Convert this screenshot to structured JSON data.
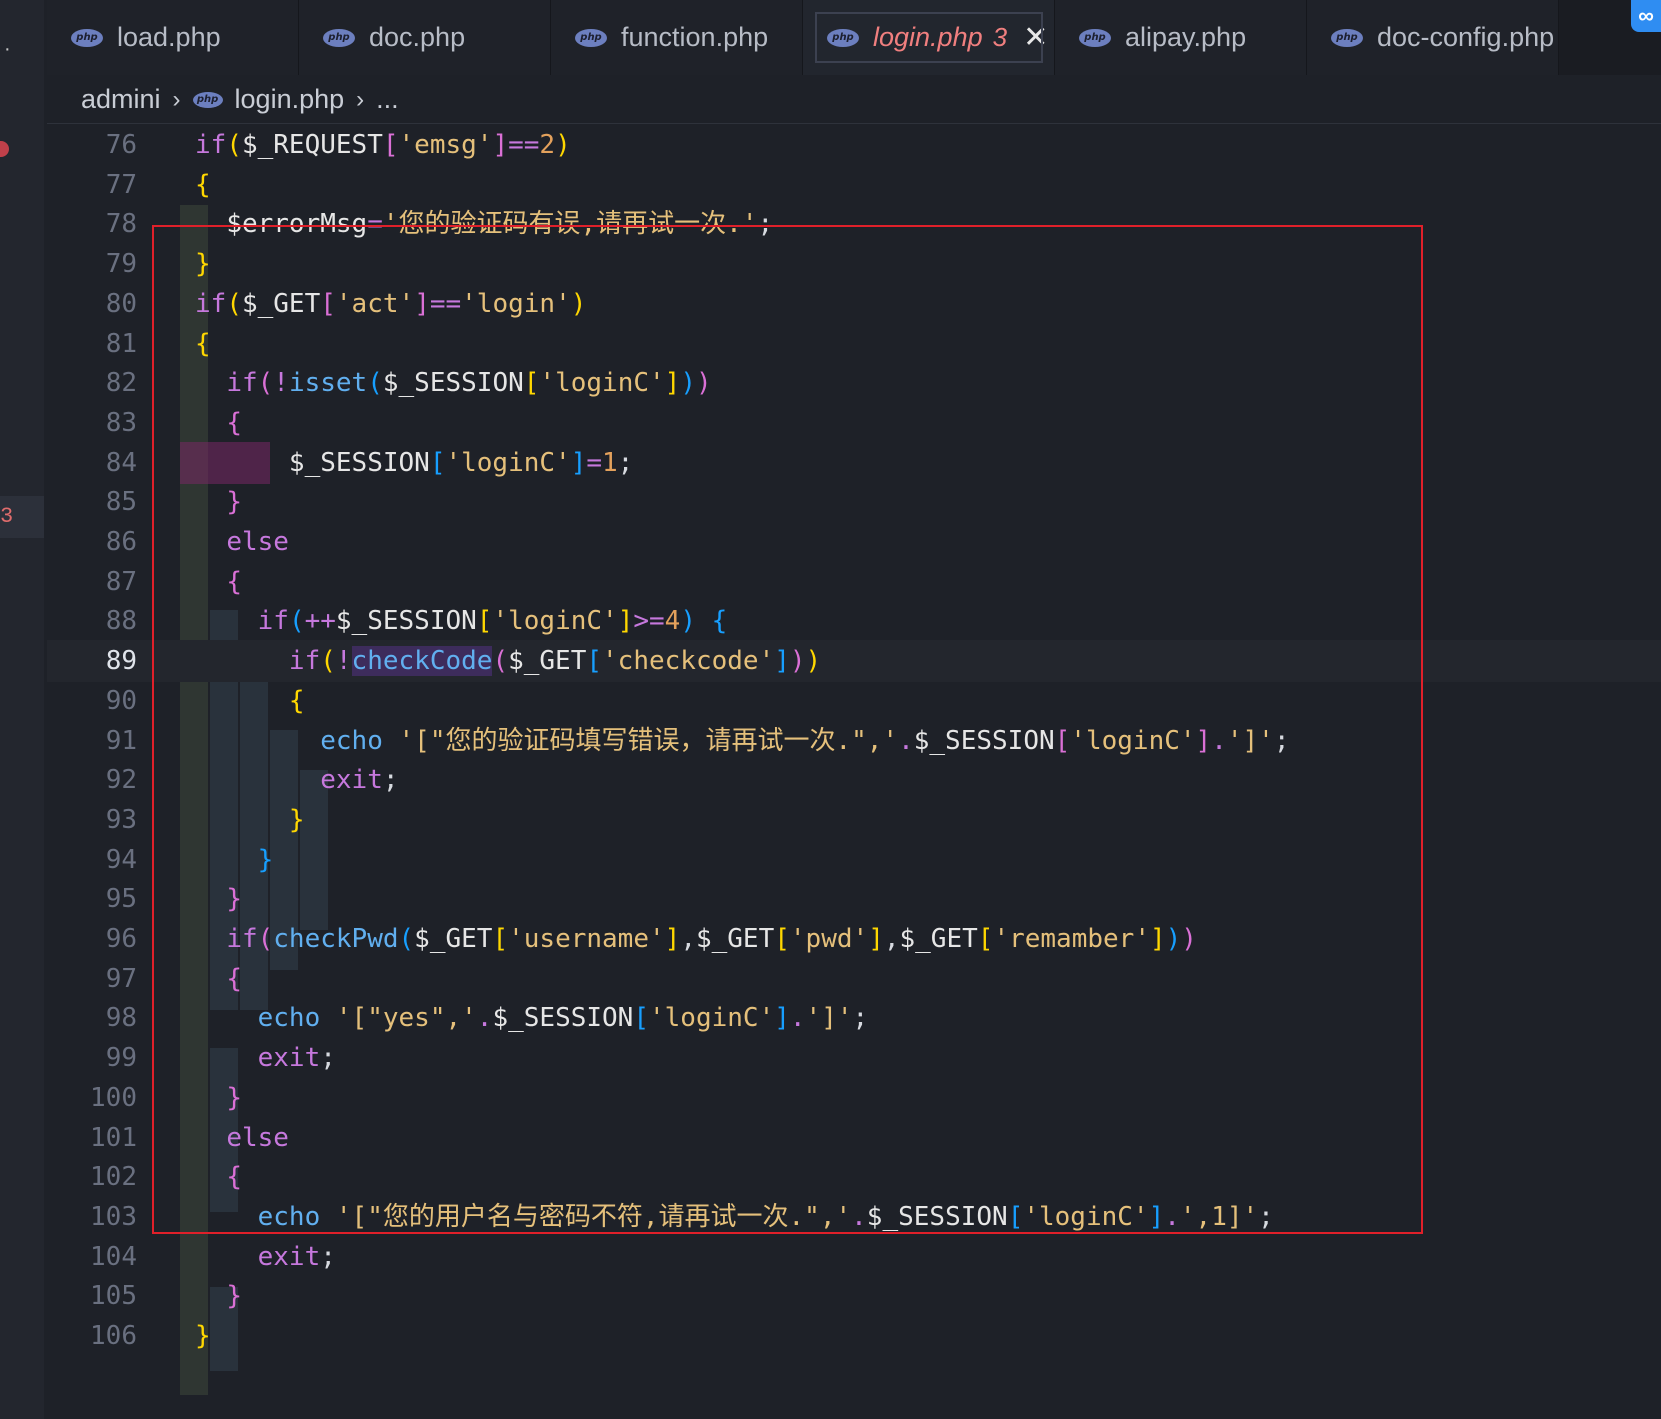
{
  "tabs": [
    {
      "label": "load.php",
      "icon": "php-file-icon",
      "active": false
    },
    {
      "label": "doc.php",
      "icon": "php-file-icon",
      "active": false
    },
    {
      "label": "function.php",
      "icon": "php-file-icon",
      "active": false
    },
    {
      "label": "login.php",
      "count": "3",
      "icon": "php-file-icon",
      "active": true
    },
    {
      "label": "alipay.php",
      "icon": "php-file-icon",
      "active": false
    },
    {
      "label": "doc-config.php",
      "icon": "php-file-icon",
      "active": false
    }
  ],
  "php_icon_text": "php",
  "close_glyph": "✕",
  "activity": {
    "dot": "·",
    "problem_count": "3"
  },
  "breadcrumb": {
    "folder": "admini",
    "file": "login.php",
    "more": "...",
    "sep": "›"
  },
  "current_line": 89,
  "lines": [
    {
      "n": "76"
    },
    {
      "n": "77"
    },
    {
      "n": "78"
    },
    {
      "n": "79"
    },
    {
      "n": "80"
    },
    {
      "n": "81"
    },
    {
      "n": "82"
    },
    {
      "n": "83"
    },
    {
      "n": "84"
    },
    {
      "n": "85"
    },
    {
      "n": "86"
    },
    {
      "n": "87"
    },
    {
      "n": "88"
    },
    {
      "n": "89"
    },
    {
      "n": "90"
    },
    {
      "n": "91"
    },
    {
      "n": "92"
    },
    {
      "n": "93"
    },
    {
      "n": "94"
    },
    {
      "n": "95"
    },
    {
      "n": "96"
    },
    {
      "n": "97"
    },
    {
      "n": "98"
    },
    {
      "n": "99"
    },
    {
      "n": "100"
    },
    {
      "n": "101"
    },
    {
      "n": "102"
    },
    {
      "n": "103"
    },
    {
      "n": "104"
    },
    {
      "n": "105"
    },
    {
      "n": "106"
    }
  ],
  "code": {
    "l76": [
      [
        "kw",
        "if"
      ],
      [
        "br1",
        "("
      ],
      [
        "var",
        "$_REQUEST"
      ],
      [
        "br2",
        "["
      ],
      [
        "str",
        "'emsg'"
      ],
      [
        "br2",
        "]"
      ],
      [
        "op",
        "=="
      ],
      [
        "num",
        "2"
      ],
      [
        "br1",
        ")"
      ]
    ],
    "l77": [
      [
        "br1",
        "{"
      ]
    ],
    "l78": [
      [
        "plain",
        "  "
      ],
      [
        "var",
        "$errorMsg"
      ],
      [
        "op",
        "="
      ],
      [
        "str",
        "'您的验证码有误,请再试一次.'"
      ],
      [
        "plain",
        ";"
      ]
    ],
    "l79": [
      [
        "br1",
        "}"
      ]
    ],
    "l80": [
      [
        "kw",
        "if"
      ],
      [
        "br1",
        "("
      ],
      [
        "var",
        "$_GET"
      ],
      [
        "br2",
        "["
      ],
      [
        "str",
        "'act'"
      ],
      [
        "br2",
        "]"
      ],
      [
        "op",
        "=="
      ],
      [
        "str",
        "'login'"
      ],
      [
        "br1",
        ")"
      ]
    ],
    "l81": [
      [
        "br1",
        "{"
      ]
    ],
    "l82": [
      [
        "plain",
        "  "
      ],
      [
        "kw",
        "if"
      ],
      [
        "br2",
        "("
      ],
      [
        "op",
        "!"
      ],
      [
        "fn",
        "isset"
      ],
      [
        "br3",
        "("
      ],
      [
        "var",
        "$_SESSION"
      ],
      [
        "br1",
        "["
      ],
      [
        "str",
        "'loginC'"
      ],
      [
        "br1",
        "]"
      ],
      [
        "br3",
        ")"
      ],
      [
        "br2",
        ")"
      ]
    ],
    "l83": [
      [
        "plain",
        "  "
      ],
      [
        "br2",
        "{"
      ]
    ],
    "l84": [
      [
        "plain",
        "      "
      ],
      [
        "var",
        "$_SESSION"
      ],
      [
        "br3",
        "["
      ],
      [
        "str",
        "'loginC'"
      ],
      [
        "br3",
        "]"
      ],
      [
        "op",
        "="
      ],
      [
        "num",
        "1"
      ],
      [
        "plain",
        ";"
      ]
    ],
    "l85": [
      [
        "plain",
        "  "
      ],
      [
        "br2",
        "}"
      ]
    ],
    "l86": [
      [
        "plain",
        "  "
      ],
      [
        "kw",
        "else"
      ]
    ],
    "l87": [
      [
        "plain",
        "  "
      ],
      [
        "br2",
        "{"
      ]
    ],
    "l88": [
      [
        "plain",
        "    "
      ],
      [
        "kw",
        "if"
      ],
      [
        "br3",
        "("
      ],
      [
        "op",
        "++"
      ],
      [
        "var",
        "$_SESSION"
      ],
      [
        "br1",
        "["
      ],
      [
        "str",
        "'loginC'"
      ],
      [
        "br1",
        "]"
      ],
      [
        "op",
        ">="
      ],
      [
        "num",
        "4"
      ],
      [
        "br3",
        ")"
      ],
      [
        "plain",
        " "
      ],
      [
        "br3",
        "{"
      ]
    ],
    "l89": [
      [
        "plain",
        "      "
      ],
      [
        "kw",
        "if"
      ],
      [
        "br1",
        "("
      ],
      [
        "op",
        "!"
      ],
      [
        "fnhl",
        "checkCode"
      ],
      [
        "br2",
        "("
      ],
      [
        "var",
        "$_GET"
      ],
      [
        "br3",
        "["
      ],
      [
        "str",
        "'checkcode'"
      ],
      [
        "br3",
        "]"
      ],
      [
        "br2",
        ")"
      ],
      [
        "br1",
        ")"
      ]
    ],
    "l90": [
      [
        "plain",
        "      "
      ],
      [
        "br1",
        "{"
      ]
    ],
    "l91": [
      [
        "plain",
        "        "
      ],
      [
        "fn",
        "echo"
      ],
      [
        "plain",
        " "
      ],
      [
        "str",
        "'[\"您的验证码填写错误，请再试一次.\",'"
      ],
      [
        "op",
        "."
      ],
      [
        "var",
        "$_SESSION"
      ],
      [
        "br2",
        "["
      ],
      [
        "str",
        "'loginC'"
      ],
      [
        "br2",
        "]"
      ],
      [
        "op",
        "."
      ],
      [
        "str",
        "']'"
      ],
      [
        "plain",
        ";"
      ]
    ],
    "l92": [
      [
        "plain",
        "        "
      ],
      [
        "kw",
        "exit"
      ],
      [
        "plain",
        ";"
      ]
    ],
    "l93": [
      [
        "plain",
        "      "
      ],
      [
        "br1",
        "}"
      ]
    ],
    "l94": [
      [
        "plain",
        "    "
      ],
      [
        "br3",
        "}"
      ]
    ],
    "l95": [
      [
        "plain",
        "  "
      ],
      [
        "br2",
        "}"
      ]
    ],
    "l96": [
      [
        "plain",
        "  "
      ],
      [
        "kw",
        "if"
      ],
      [
        "br2",
        "("
      ],
      [
        "fn",
        "checkPwd"
      ],
      [
        "br3",
        "("
      ],
      [
        "var",
        "$_GET"
      ],
      [
        "br1",
        "["
      ],
      [
        "str",
        "'username'"
      ],
      [
        "br1",
        "]"
      ],
      [
        "plain",
        ","
      ],
      [
        "var",
        "$_GET"
      ],
      [
        "br1",
        "["
      ],
      [
        "str",
        "'pwd'"
      ],
      [
        "br1",
        "]"
      ],
      [
        "plain",
        ","
      ],
      [
        "var",
        "$_GET"
      ],
      [
        "br1",
        "["
      ],
      [
        "str",
        "'remamber'"
      ],
      [
        "br1",
        "]"
      ],
      [
        "br3",
        ")"
      ],
      [
        "br2",
        ")"
      ]
    ],
    "l97": [
      [
        "plain",
        "  "
      ],
      [
        "br2",
        "{"
      ]
    ],
    "l98": [
      [
        "plain",
        "    "
      ],
      [
        "fn",
        "echo"
      ],
      [
        "plain",
        " "
      ],
      [
        "str",
        "'[\"yes\",'"
      ],
      [
        "op",
        "."
      ],
      [
        "var",
        "$_SESSION"
      ],
      [
        "br3",
        "["
      ],
      [
        "str",
        "'loginC'"
      ],
      [
        "br3",
        "]"
      ],
      [
        "op",
        "."
      ],
      [
        "str",
        "']'"
      ],
      [
        "plain",
        ";"
      ]
    ],
    "l99": [
      [
        "plain",
        "    "
      ],
      [
        "kw",
        "exit"
      ],
      [
        "plain",
        ";"
      ]
    ],
    "l100": [
      [
        "plain",
        "  "
      ],
      [
        "br2",
        "}"
      ]
    ],
    "l101": [
      [
        "plain",
        "  "
      ],
      [
        "kw",
        "else"
      ]
    ],
    "l102": [
      [
        "plain",
        "  "
      ],
      [
        "br2",
        "{"
      ]
    ],
    "l103": [
      [
        "plain",
        "    "
      ],
      [
        "fn",
        "echo"
      ],
      [
        "plain",
        " "
      ],
      [
        "str",
        "'[\"您的用户名与密码不符,请再试一次.\",'"
      ],
      [
        "op",
        "."
      ],
      [
        "var",
        "$_SESSION"
      ],
      [
        "br3",
        "["
      ],
      [
        "str",
        "'loginC'"
      ],
      [
        "br3",
        "]"
      ],
      [
        "op",
        "."
      ],
      [
        "str",
        "',1]'"
      ],
      [
        "plain",
        ";"
      ]
    ],
    "l104": [
      [
        "plain",
        "    "
      ],
      [
        "kw",
        "exit"
      ],
      [
        "plain",
        ";"
      ]
    ],
    "l105": [
      [
        "plain",
        "  "
      ],
      [
        "br2",
        "}"
      ]
    ],
    "l106": [
      [
        "br1",
        "}"
      ]
    ]
  },
  "colors": {
    "highlight_box": "#e0202a",
    "active_tab_text": "#f07f7f"
  }
}
